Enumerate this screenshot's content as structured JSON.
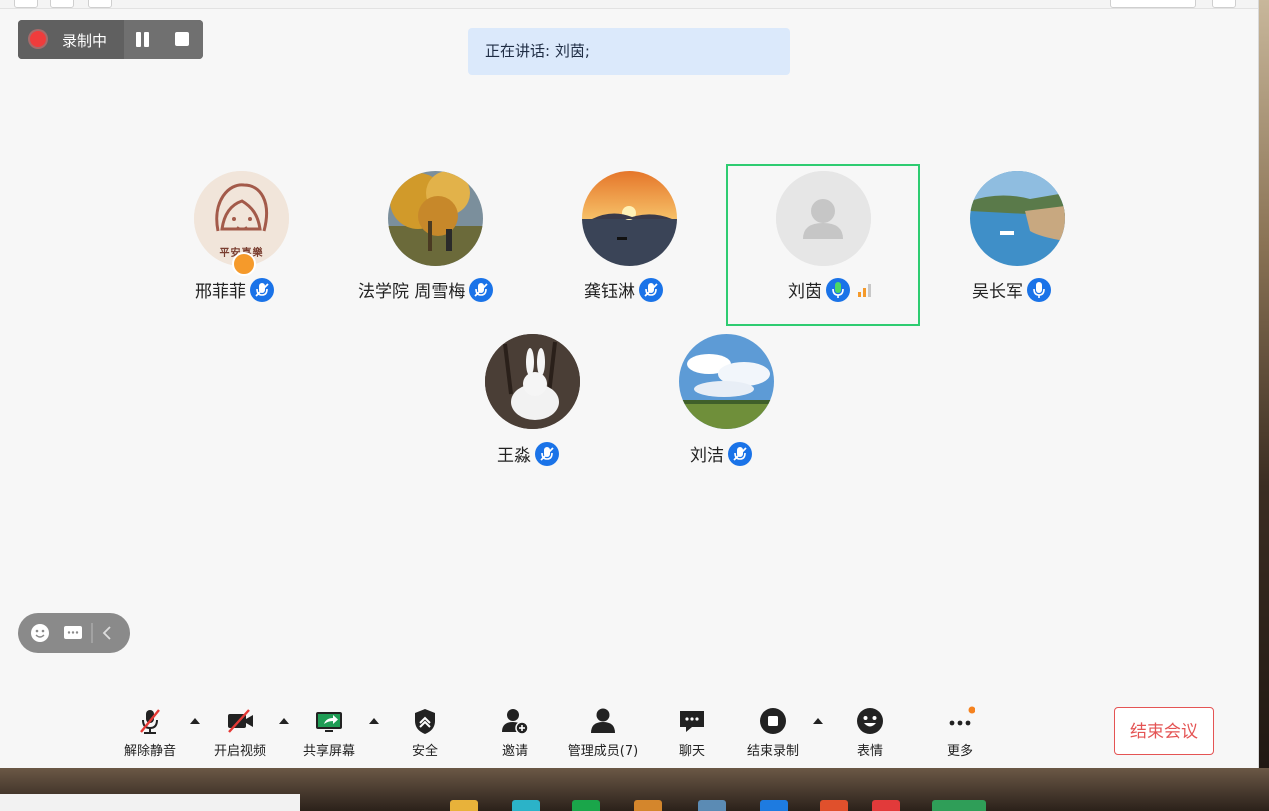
{
  "recording": {
    "status_label": "录制中"
  },
  "speaking_banner": "正在讲话: 刘茵;",
  "participants": [
    {
      "name": "邢菲菲",
      "mic": "muted"
    },
    {
      "name": "法学院 周雪梅",
      "mic": "muted"
    },
    {
      "name": "龚钰淋",
      "mic": "muted"
    },
    {
      "name": "刘茵",
      "mic": "speaking"
    },
    {
      "name": "吴长军",
      "mic": "on"
    },
    {
      "name": "王淼",
      "mic": "muted"
    },
    {
      "name": "刘洁",
      "mic": "muted"
    }
  ],
  "avatar_badge_text": "平安喜樂",
  "toolbar": {
    "unmute": "解除静音",
    "start_video": "开启视频",
    "share_screen": "共享屏幕",
    "security": "安全",
    "invite": "邀请",
    "manage_members": "管理成员(7)",
    "chat": "聊天",
    "end_recording": "结束录制",
    "reactions": "表情",
    "more": "更多"
  },
  "end_meeting": "结束会议",
  "colors": {
    "accent_blue": "#1a73e8",
    "active_green": "#2ecc71",
    "end_red": "#e45454",
    "record_red": "#f03c3c"
  }
}
